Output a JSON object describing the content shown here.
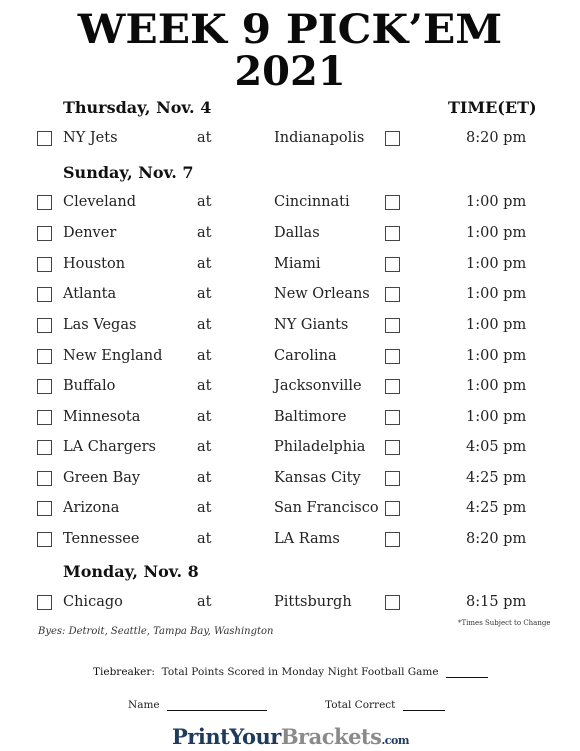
{
  "header": {
    "title_line1": "WEEK 9 PICK’EM",
    "title_line2": "2021",
    "time_header": "TIME(ET)"
  },
  "days": [
    {
      "label": "Thursday, Nov. 4",
      "games": [
        {
          "away": "NY Jets",
          "at": "at",
          "home": "Indianapolis",
          "time": "8:20 pm"
        }
      ]
    },
    {
      "label": "Sunday, Nov. 7",
      "games": [
        {
          "away": "Cleveland",
          "at": "at",
          "home": "Cincinnati",
          "time": "1:00 pm"
        },
        {
          "away": "Denver",
          "at": "at",
          "home": "Dallas",
          "time": "1:00 pm"
        },
        {
          "away": "Houston",
          "at": "at",
          "home": "Miami",
          "time": "1:00 pm"
        },
        {
          "away": "Atlanta",
          "at": "at",
          "home": "New Orleans",
          "time": "1:00 pm"
        },
        {
          "away": "Las Vegas",
          "at": "at",
          "home": "NY Giants",
          "time": "1:00 pm"
        },
        {
          "away": "New England",
          "at": "at",
          "home": "Carolina",
          "time": "1:00 pm"
        },
        {
          "away": "Buffalo",
          "at": "at",
          "home": "Jacksonville",
          "time": "1:00 pm"
        },
        {
          "away": "Minnesota",
          "at": "at",
          "home": "Baltimore",
          "time": "1:00 pm"
        },
        {
          "away": "LA Chargers",
          "at": "at",
          "home": "Philadelphia",
          "time": "4:05 pm"
        },
        {
          "away": "Green Bay",
          "at": "at",
          "home": "Kansas City",
          "time": "4:25 pm"
        },
        {
          "away": "Arizona",
          "at": "at",
          "home": "San Francisco",
          "time": "4:25 pm"
        },
        {
          "away": "Tennessee",
          "at": "at",
          "home": "LA Rams",
          "time": "8:20 pm"
        }
      ]
    },
    {
      "label": "Monday, Nov. 8",
      "games": [
        {
          "away": "Chicago",
          "at": "at",
          "home": "Pittsburgh",
          "time": "8:15 pm"
        }
      ]
    }
  ],
  "footer": {
    "byes": "Byes: Detroit, Seattle, Tampa Bay, Washington",
    "times_note": "*Times Subject to Change",
    "tiebreaker_label": "Tiebreaker:",
    "tiebreaker_text": "Total Points Scored in Monday Night Football Game",
    "name_label": "Name",
    "total_correct_label": "Total Correct",
    "logo_part1": "PrintYour",
    "logo_part2": "Brackets",
    "logo_part3": ".com"
  }
}
